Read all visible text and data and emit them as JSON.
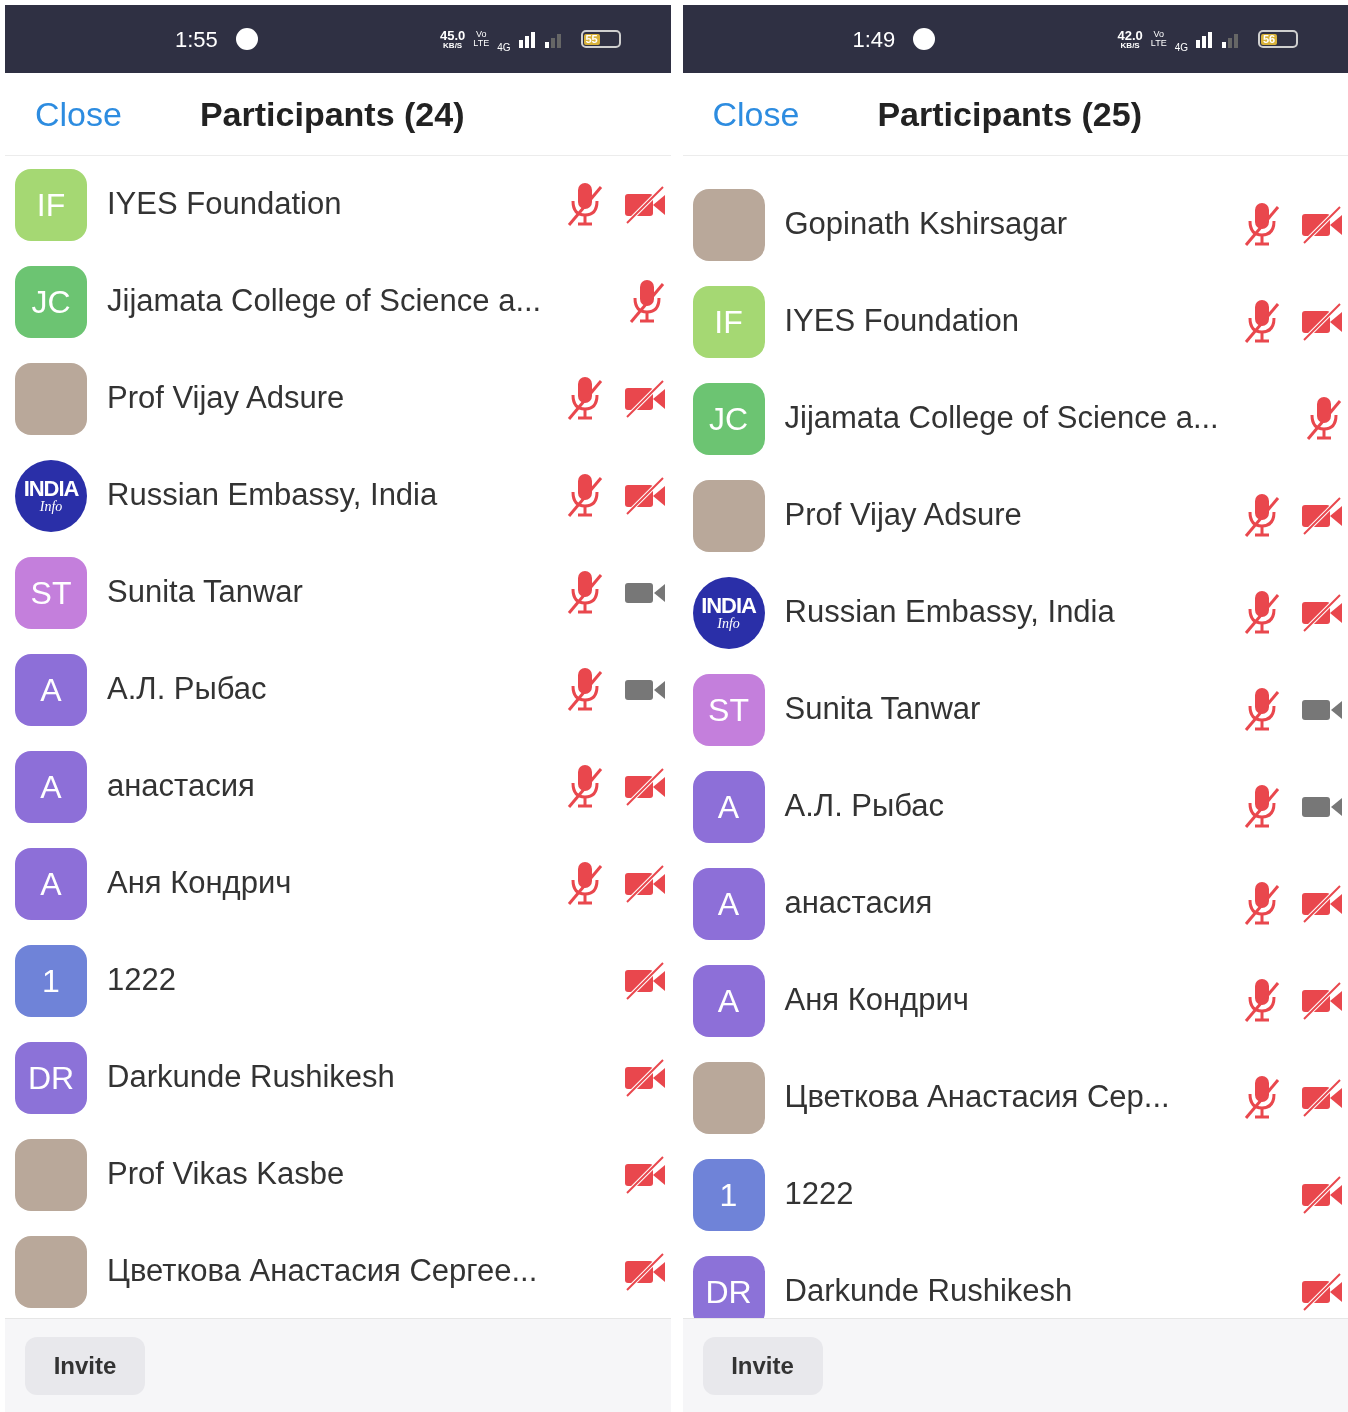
{
  "screens": [
    {
      "status_bar": {
        "time": "1:55",
        "speed": "45.0",
        "speed_unit": "KB/S",
        "volte_top": "Vo",
        "volte_bottom": "LTE",
        "network": "4G",
        "battery": "55"
      },
      "header": {
        "close": "Close",
        "title": "Participants (24)"
      },
      "participants": [
        {
          "name": "IYES Foundation",
          "avatar": {
            "kind": "initials",
            "text": "IF",
            "color": "#a5d873"
          },
          "mic_muted": true,
          "video": {
            "kind": "off"
          }
        },
        {
          "name": "Jijamata College of Science a...",
          "avatar": {
            "kind": "initials",
            "text": "JC",
            "color": "#6cc472"
          },
          "mic_muted": true
        },
        {
          "name": "Prof Vijay Adsure",
          "avatar": {
            "kind": "photo"
          },
          "mic_muted": true,
          "video": {
            "kind": "off"
          }
        },
        {
          "name": "Russian Embassy, India",
          "avatar": {
            "kind": "logo",
            "lines": [
              "INDIA",
              "Info"
            ]
          },
          "mic_muted": true,
          "video": {
            "kind": "off"
          }
        },
        {
          "name": "Sunita Tanwar",
          "avatar": {
            "kind": "initials",
            "text": "ST",
            "color": "#c47fdc"
          },
          "mic_muted": true,
          "video": {
            "kind": "on"
          }
        },
        {
          "name": "А.Л. Рыбас",
          "avatar": {
            "kind": "initials",
            "text": "A",
            "color": "#8d6fd8"
          },
          "mic_muted": true,
          "video": {
            "kind": "on"
          }
        },
        {
          "name": "анастасия",
          "avatar": {
            "kind": "initials",
            "text": "A",
            "color": "#8d6fd8"
          },
          "mic_muted": true,
          "video": {
            "kind": "off"
          }
        },
        {
          "name": "Аня Кондрич",
          "avatar": {
            "kind": "initials",
            "text": "A",
            "color": "#8d6fd8"
          },
          "mic_muted": true,
          "video": {
            "kind": "off"
          }
        },
        {
          "name": "1222",
          "avatar": {
            "kind": "initials",
            "text": "1",
            "color": "#6f83d8"
          },
          "mic_muted": false,
          "video": {
            "kind": "off"
          }
        },
        {
          "name": "Darkunde Rushikesh",
          "avatar": {
            "kind": "initials",
            "text": "DR",
            "color": "#8c72d8"
          },
          "mic_muted": false,
          "video": {
            "kind": "off"
          }
        },
        {
          "name": "Prof Vikas Kasbe",
          "avatar": {
            "kind": "photo"
          },
          "mic_muted": false,
          "video": {
            "kind": "off"
          }
        },
        {
          "name": "Цветкова Анастасия Сергее...",
          "avatar": {
            "kind": "photo"
          },
          "mic_muted": false,
          "video": {
            "kind": "off"
          }
        }
      ],
      "invite": "Invite"
    },
    {
      "status_bar": {
        "time": "1:49",
        "speed": "42.0",
        "speed_unit": "KB/S",
        "volte_top": "Vo",
        "volte_bottom": "LTE",
        "network": "4G",
        "battery": "56"
      },
      "header": {
        "close": "Close",
        "title": "Participants (25)"
      },
      "participants": [
        {
          "name": "Gopinath Kshirsagar",
          "avatar": {
            "kind": "photo"
          },
          "mic_muted": true,
          "video": {
            "kind": "off"
          }
        },
        {
          "name": "IYES Foundation",
          "avatar": {
            "kind": "initials",
            "text": "IF",
            "color": "#a5d873"
          },
          "mic_muted": true,
          "video": {
            "kind": "off"
          }
        },
        {
          "name": "Jijamata College of Science a...",
          "avatar": {
            "kind": "initials",
            "text": "JC",
            "color": "#6cc472"
          },
          "mic_muted": true
        },
        {
          "name": "Prof Vijay Adsure",
          "avatar": {
            "kind": "photo"
          },
          "mic_muted": true,
          "video": {
            "kind": "off"
          }
        },
        {
          "name": "Russian Embassy, India",
          "avatar": {
            "kind": "logo",
            "lines": [
              "INDIA",
              "Info"
            ]
          },
          "mic_muted": true,
          "video": {
            "kind": "off"
          }
        },
        {
          "name": "Sunita Tanwar",
          "avatar": {
            "kind": "initials",
            "text": "ST",
            "color": "#c47fdc"
          },
          "mic_muted": true,
          "video": {
            "kind": "on"
          }
        },
        {
          "name": "А.Л. Рыбас",
          "avatar": {
            "kind": "initials",
            "text": "A",
            "color": "#8d6fd8"
          },
          "mic_muted": true,
          "video": {
            "kind": "on"
          }
        },
        {
          "name": "анастасия",
          "avatar": {
            "kind": "initials",
            "text": "A",
            "color": "#8d6fd8"
          },
          "mic_muted": true,
          "video": {
            "kind": "off"
          }
        },
        {
          "name": "Аня Кондрич",
          "avatar": {
            "kind": "initials",
            "text": "A",
            "color": "#8d6fd8"
          },
          "mic_muted": true,
          "video": {
            "kind": "off"
          }
        },
        {
          "name": "Цветкова Анастасия Сер...",
          "avatar": {
            "kind": "photo"
          },
          "mic_muted": true,
          "video": {
            "kind": "off"
          }
        },
        {
          "name": "1222",
          "avatar": {
            "kind": "initials",
            "text": "1",
            "color": "#6f83d8"
          },
          "mic_muted": false,
          "video": {
            "kind": "off"
          }
        },
        {
          "name": "Darkunde Rushikesh",
          "avatar": {
            "kind": "initials",
            "text": "DR",
            "color": "#8c72d8"
          },
          "mic_muted": false,
          "video": {
            "kind": "off"
          }
        }
      ],
      "invite": "Invite"
    }
  ]
}
